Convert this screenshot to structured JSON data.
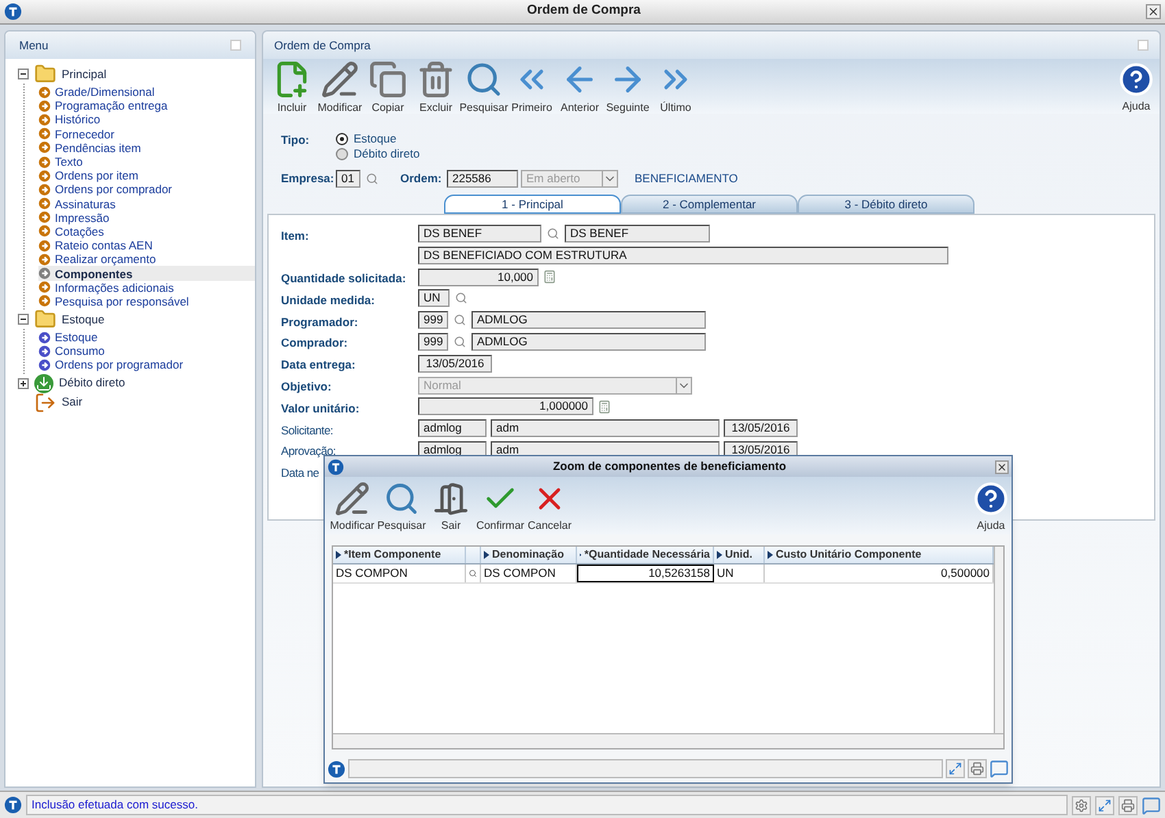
{
  "window": {
    "title": "Ordem de Compra"
  },
  "menu": {
    "title": "Menu",
    "tree": [
      {
        "label": "Principal",
        "kind": "folder",
        "expanded": true,
        "children": [
          {
            "label": "Grade/Dimensional",
            "color": "#c8740a",
            "selected": false
          },
          {
            "label": "Programação entrega",
            "color": "#c8740a",
            "selected": false
          },
          {
            "label": "Histórico",
            "color": "#c8740a",
            "selected": false
          },
          {
            "label": "Fornecedor",
            "color": "#c8740a",
            "selected": false
          },
          {
            "label": "Pendências item",
            "color": "#c8740a",
            "selected": false
          },
          {
            "label": "Texto",
            "color": "#c8740a",
            "selected": false
          },
          {
            "label": "Ordens por item",
            "color": "#c8740a",
            "selected": false
          },
          {
            "label": "Ordens por comprador",
            "color": "#c8740a",
            "selected": false
          },
          {
            "label": "Assinaturas",
            "color": "#c8740a",
            "selected": false
          },
          {
            "label": "Impressão",
            "color": "#c8740a",
            "selected": false
          },
          {
            "label": "Cotações",
            "color": "#c8740a",
            "selected": false
          },
          {
            "label": "Rateio contas AEN",
            "color": "#c8740a",
            "selected": false
          },
          {
            "label": "Realizar orçamento",
            "color": "#c8740a",
            "selected": false
          },
          {
            "label": "Componentes",
            "color": "#808080",
            "selected": true
          },
          {
            "label": "Informações adicionais",
            "color": "#c8740a",
            "selected": false
          },
          {
            "label": "Pesquisa por responsável",
            "color": "#c8740a",
            "selected": false
          }
        ]
      },
      {
        "label": "Estoque",
        "kind": "folder",
        "expanded": true,
        "children": [
          {
            "label": "Estoque",
            "color": "#4a4fc8",
            "selected": false
          },
          {
            "label": "Consumo",
            "color": "#4a4fc8",
            "selected": false
          },
          {
            "label": "Ordens por programador",
            "color": "#4a4fc8",
            "selected": false
          }
        ]
      },
      {
        "label": "Débito direto",
        "kind": "download",
        "expanded": false
      },
      {
        "label": "Sair",
        "kind": "exit"
      }
    ]
  },
  "form": {
    "title": "Ordem de Compra",
    "toolbar": [
      {
        "label": "Incluir",
        "kind": "add"
      },
      {
        "label": "Modificar",
        "kind": "edit"
      },
      {
        "label": "Copiar",
        "kind": "copy"
      },
      {
        "label": "Excluir",
        "kind": "delete"
      },
      {
        "label": "Pesquisar",
        "kind": "search"
      },
      {
        "label": "Primeiro",
        "kind": "first"
      },
      {
        "label": "Anterior",
        "kind": "prev"
      },
      {
        "label": "Seguinte",
        "kind": "next"
      },
      {
        "label": "Último",
        "kind": "last"
      }
    ],
    "help": "Ajuda",
    "tipo": {
      "label": "Tipo:",
      "options": [
        {
          "label": "Estoque",
          "selected": true
        },
        {
          "label": "Débito direto",
          "selected": false
        }
      ]
    },
    "empresa": {
      "label": "Empresa:",
      "value": "01"
    },
    "ordem": {
      "label": "Ordem:",
      "value": "225586",
      "status": "Em aberto",
      "type": "BENEFICIAMENTO"
    },
    "tabs": [
      {
        "label": "1 - Principal",
        "selected": true
      },
      {
        "label": "2 - Complementar",
        "selected": false
      },
      {
        "label": "3 - Débito direto",
        "selected": false
      }
    ],
    "fields": [
      {
        "kind": "item",
        "label": "Item:",
        "required": true,
        "values": [
          "DS BENEF",
          "DS BENEF"
        ]
      },
      {
        "kind": "wide",
        "values": [
          "DS BENEFICIADO COM ESTRUTURA"
        ]
      },
      {
        "kind": "quantity",
        "label": "Quantidade solicitada:",
        "required": true,
        "values": [
          "10,000"
        ]
      },
      {
        "kind": "unit",
        "label": "Unidade medida:",
        "required": true,
        "values": [
          "UN"
        ]
      },
      {
        "kind": "person",
        "label": "Programador:",
        "required": true,
        "values": [
          "999",
          "ADMLOG"
        ]
      },
      {
        "kind": "person",
        "label": "Comprador:",
        "required": true,
        "values": [
          "999",
          "ADMLOG"
        ]
      },
      {
        "kind": "date",
        "label": "Data entrega:",
        "required": true,
        "values": [
          "13/05/2016"
        ]
      },
      {
        "kind": "select",
        "label": "Objetivo:",
        "required": true,
        "values": [
          "Normal"
        ]
      },
      {
        "kind": "price",
        "label": "Valor unitário:",
        "required": true,
        "values": [
          "1,000000"
        ]
      },
      {
        "kind": "signature",
        "label": "Solicitante:",
        "required": false,
        "values": [
          "admlog",
          "adm",
          "13/05/2016"
        ]
      },
      {
        "kind": "signature",
        "label": "Aprovação:",
        "required": false,
        "values": [
          "admlog",
          "adm",
          "13/05/2016"
        ]
      },
      {
        "kind": "label_only",
        "label": "Data ne",
        "required": false
      }
    ]
  },
  "dialog": {
    "title": "Zoom de componentes de beneficiamento",
    "toolbar": [
      {
        "label": "Modificar",
        "kind": "edit"
      },
      {
        "label": "Pesquisar",
        "kind": "search"
      },
      {
        "label": "Sair",
        "kind": "exit"
      },
      {
        "label": "Confirmar",
        "kind": "confirm"
      },
      {
        "label": "Cancelar",
        "kind": "cancel"
      }
    ],
    "help": "Ajuda",
    "columns": [
      {
        "label": "*Item Componente",
        "kind": "text"
      },
      {
        "kind": "lookup"
      },
      {
        "label": "Denominação",
        "kind": "text"
      },
      {
        "label": "*Quantidade Necessária",
        "kind": "number"
      },
      {
        "label": "Unid.",
        "kind": "text"
      },
      {
        "label": "Custo Unitário Componente",
        "kind": "number"
      }
    ],
    "rows": [
      {
        "cells": [
          {
            "text": "DS COMPON",
            "focused": false
          },
          {
            "focused": false
          },
          {
            "text": "DS COMPON",
            "focused": false
          },
          {
            "text": "10,5263158",
            "focused": true
          },
          {
            "text": "UN",
            "focused": false
          },
          {
            "text": "0,500000",
            "focused": false
          }
        ]
      }
    ]
  },
  "status_bar": {
    "message": "Inclusão efetuada com sucesso."
  }
}
